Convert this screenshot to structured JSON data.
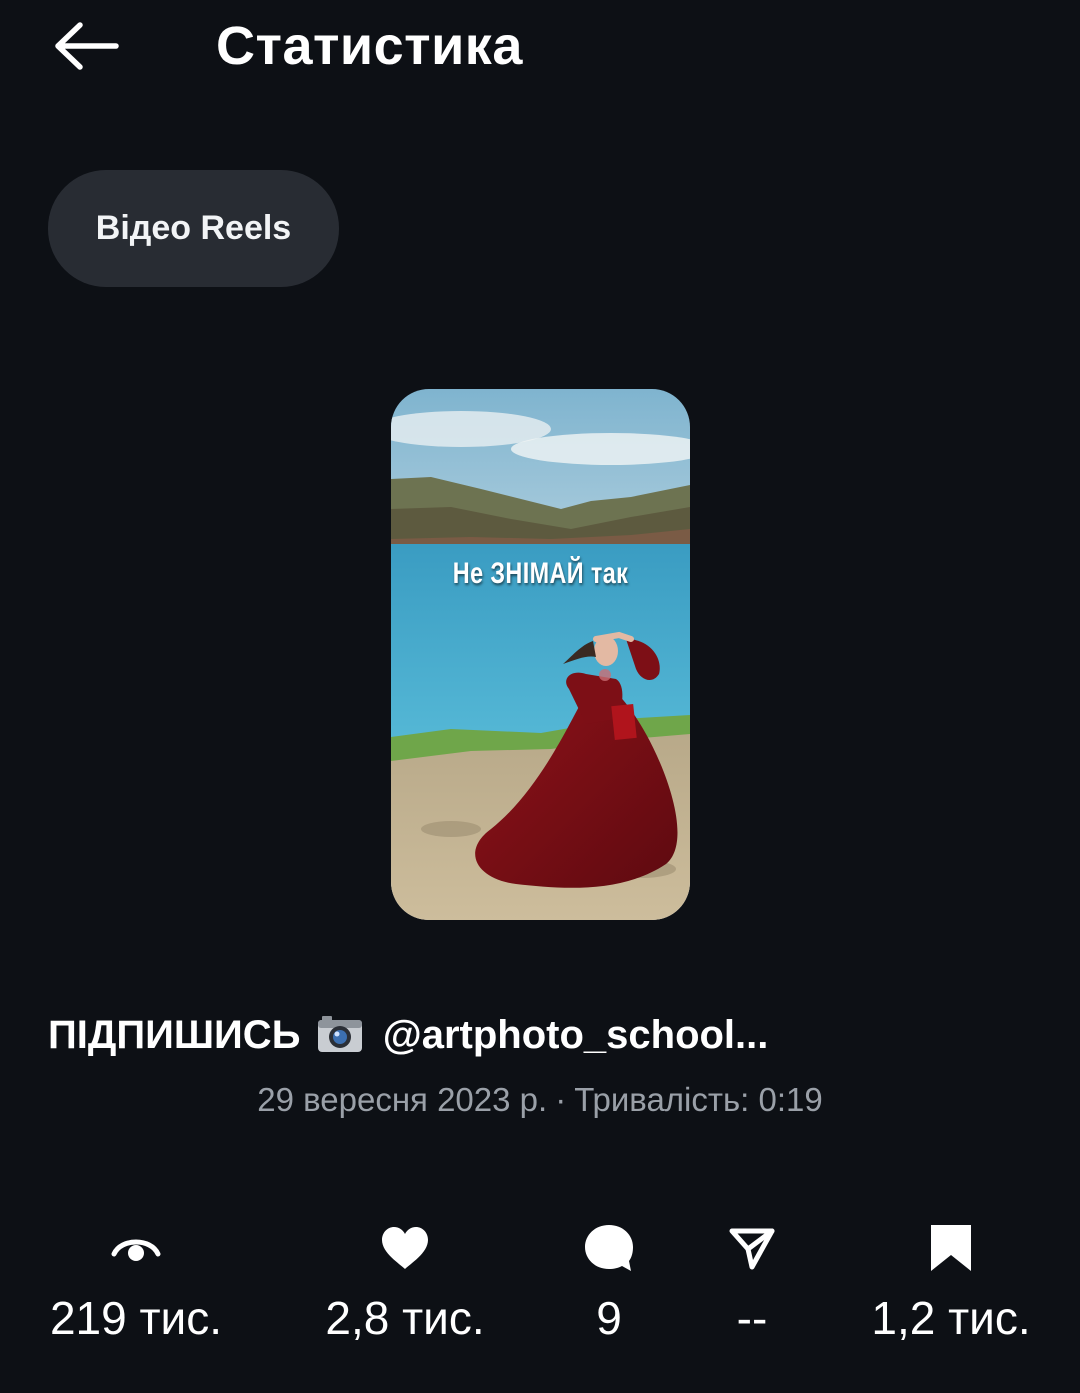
{
  "header": {
    "title": "Статистика",
    "back_icon": "arrow-left-icon"
  },
  "chip": {
    "label": "Відео Reels"
  },
  "thumbnail": {
    "overlay_text": "Не ЗНІМАЙ так"
  },
  "post": {
    "caption_prefix": "ПІДПИШИСЬ",
    "caption_icon": "camera-icon",
    "caption_suffix": "@artphoto_school...",
    "date": "29 вересня 2023 р.",
    "separator": "·",
    "duration": "Тривалість: 0:19"
  },
  "stats": [
    {
      "icon": "eye-icon",
      "value": "219 тис."
    },
    {
      "icon": "heart-icon",
      "value": "2,8 тис."
    },
    {
      "icon": "comment-icon",
      "value": "9"
    },
    {
      "icon": "share-icon",
      "value": "--"
    },
    {
      "icon": "bookmark-icon",
      "value": "1,2 тис."
    }
  ],
  "colors": {
    "background": "#0d1015",
    "chip_background": "#282c33",
    "meta_text": "#9aa0a8",
    "text": "#ffffff"
  }
}
